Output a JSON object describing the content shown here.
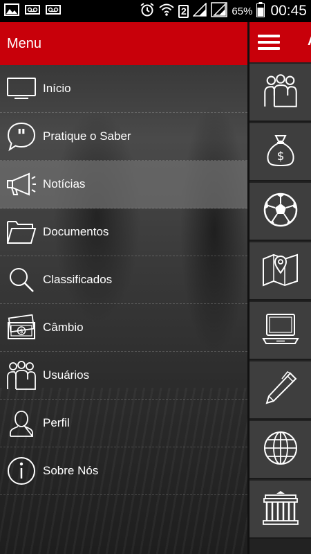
{
  "status_bar": {
    "battery_percent": "65%",
    "time": "00:45",
    "sim_slot": "2"
  },
  "drawer": {
    "title": "Menu",
    "items": [
      {
        "label": "Início",
        "icon": "tv-icon",
        "active": false
      },
      {
        "label": "Pratique o Saber",
        "icon": "quote-bubble-icon",
        "active": false
      },
      {
        "label": "Notícias",
        "icon": "megaphone-icon",
        "active": true
      },
      {
        "label": "Documentos",
        "icon": "folder-icon",
        "active": false
      },
      {
        "label": "Classificados",
        "icon": "search-icon",
        "active": false
      },
      {
        "label": "Câmbio",
        "icon": "money-bills-icon",
        "active": false
      },
      {
        "label": "Usuários",
        "icon": "users-icon",
        "active": false
      },
      {
        "label": "Perfil",
        "icon": "person-icon",
        "active": false
      },
      {
        "label": "Sobre Nós",
        "icon": "info-icon",
        "active": false
      }
    ]
  },
  "rail": {
    "header_text_fragment": "A",
    "items": [
      {
        "icon": "users-icon"
      },
      {
        "icon": "money-bag-icon"
      },
      {
        "icon": "soccer-ball-icon"
      },
      {
        "icon": "map-pin-icon"
      },
      {
        "icon": "laptop-icon"
      },
      {
        "icon": "pen-icon"
      },
      {
        "icon": "globe-icon"
      },
      {
        "icon": "monument-gate-icon"
      }
    ]
  },
  "colors": {
    "brand_red": "#c8000a",
    "active_item": "#6e6e6e"
  }
}
